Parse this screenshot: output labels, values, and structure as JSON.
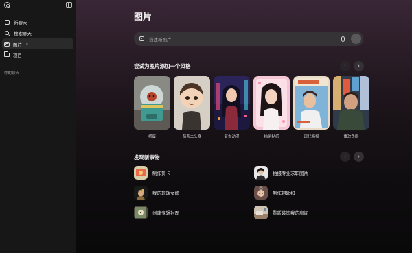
{
  "sidebar": {
    "items": [
      {
        "label": "新聊天",
        "icon": "edit-icon"
      },
      {
        "label": "搜索聊天",
        "icon": "search-icon"
      },
      {
        "label": "图片",
        "icon": "image-icon",
        "badge": "≡"
      },
      {
        "label": "项目",
        "icon": "folder-icon"
      }
    ],
    "section_label": "你的聊天",
    "section_chevron": "›"
  },
  "main": {
    "title": "图片",
    "prompt": {
      "placeholder": "描述新图片",
      "send_glyph": "↑"
    },
    "styles_section": {
      "title": "尝试为图片添加一个风格",
      "prev_glyph": "‹",
      "next_glyph": "›",
      "cards": [
        {
          "label": "扭蛋"
        },
        {
          "label": "萌系二头身"
        },
        {
          "label": "复古动漫"
        },
        {
          "label": "拍贴贴纸"
        },
        {
          "label": "现代海报"
        },
        {
          "label": "雷玟鱼眼"
        }
      ]
    },
    "discover_section": {
      "title": "发现新事物",
      "prev_glyph": "‹",
      "next_glyph": "›",
      "items": [
        {
          "label": "制作贺卡"
        },
        {
          "label": "拍摄专业求职图片"
        },
        {
          "label": "我的珍珠女郎"
        },
        {
          "label": "制作钥匙扣"
        },
        {
          "label": "创建专辑封面"
        },
        {
          "label": "重新装饰我的房间"
        }
      ]
    }
  },
  "colors": {
    "sidebar_bg": "#171717",
    "main_gradient_top": "#392636",
    "prompt_bg": "#353335"
  }
}
